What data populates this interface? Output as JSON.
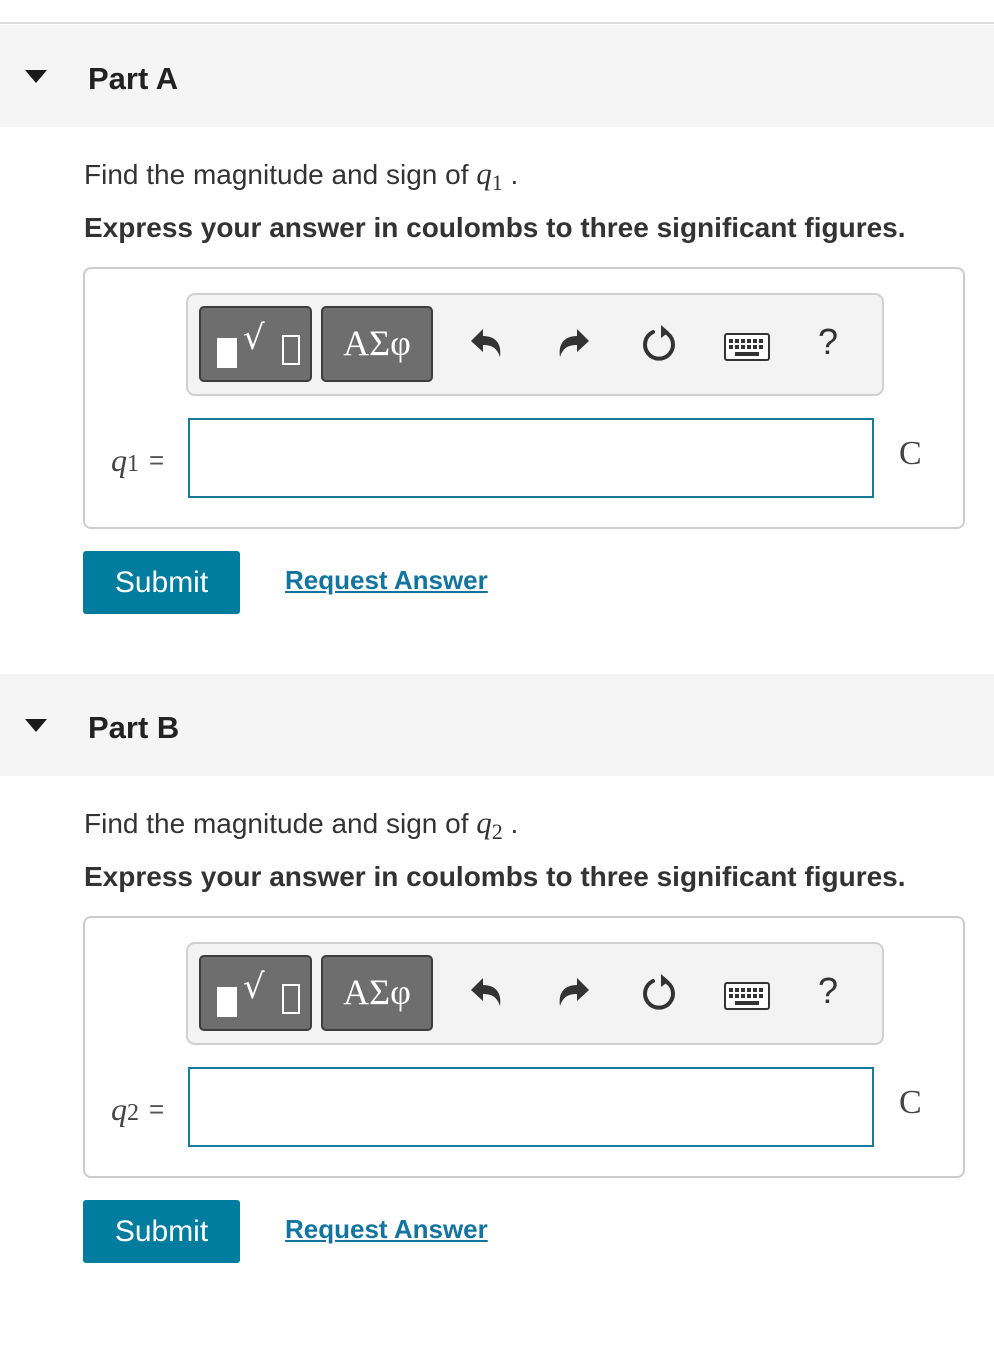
{
  "parts": [
    {
      "title": "Part A",
      "prompt_text": "Find the magnitude and sign of ",
      "prompt_var": "q",
      "prompt_sub": "1",
      "prompt_end": ".",
      "instruction": "Express your answer in coulombs to three significant figures.",
      "toolbar": {
        "greek_label": "ΑΣφ",
        "help_label": "?"
      },
      "input_var": "q",
      "input_sub": "1",
      "equals": "=",
      "input_value": "",
      "unit": "C",
      "submit_label": "Submit",
      "request_label": "Request Answer"
    },
    {
      "title": "Part B",
      "prompt_text": "Find the magnitude and sign of ",
      "prompt_var": "q",
      "prompt_sub": "2",
      "prompt_end": ".",
      "instruction": "Express your answer in coulombs to three significant figures.",
      "toolbar": {
        "greek_label": "ΑΣφ",
        "help_label": "?"
      },
      "input_var": "q",
      "input_sub": "2",
      "equals": "=",
      "input_value": "",
      "unit": "C",
      "submit_label": "Submit",
      "request_label": "Request Answer"
    }
  ],
  "icons": [
    "caret-down-icon",
    "templates-icon",
    "greek-letters-icon",
    "undo-icon",
    "redo-icon",
    "reset-icon",
    "keyboard-icon",
    "help-icon"
  ],
  "colors": {
    "accent": "#007c9e",
    "link": "#1474a0",
    "input_border": "#1a7b98",
    "header_bg": "#f5f5f5",
    "tool_button": "#6e6e6e"
  }
}
